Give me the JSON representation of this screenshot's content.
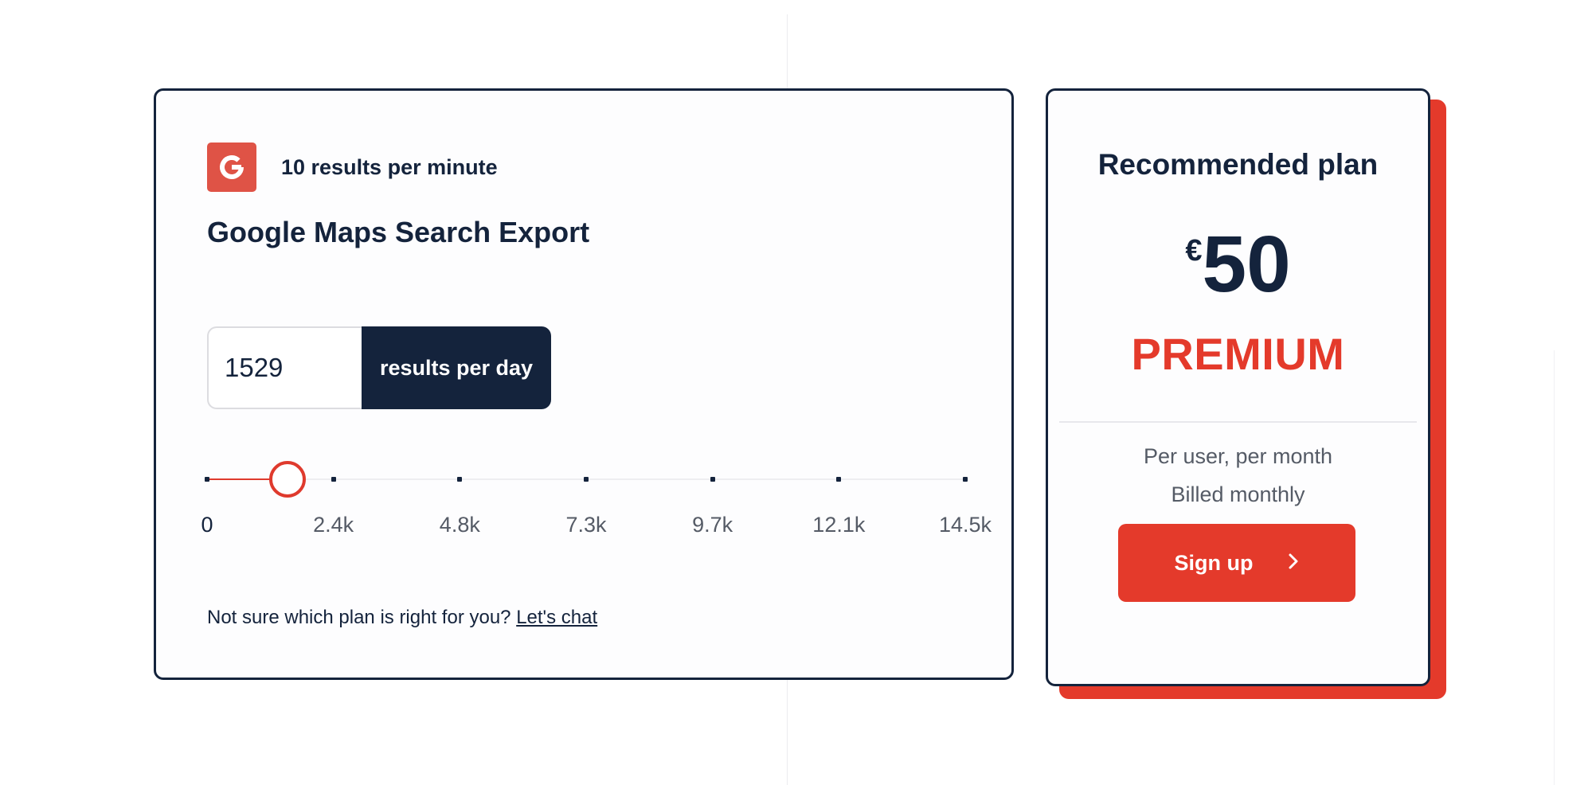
{
  "calculator": {
    "rate_text": "10 results per minute",
    "product_icon": "google-g-icon",
    "product_title": "Google Maps Search Export",
    "quantity_value": "1529",
    "quantity_unit": "results per day",
    "slider": {
      "value": 1529,
      "min": 0,
      "max": 14500,
      "ticks": [
        0,
        2400,
        4800,
        7300,
        9700,
        12100,
        14500
      ],
      "tick_labels": [
        "0",
        "2.4k",
        "4.8k",
        "7.3k",
        "9.7k",
        "12.1k",
        "14.5k"
      ]
    },
    "help_text": "Not sure which plan is right for you?",
    "help_link": "Let's chat"
  },
  "plan": {
    "heading": "Recommended plan",
    "currency": "€",
    "price": "50",
    "name": "PREMIUM",
    "meta_1": "Per user, per month",
    "meta_2": "Billed monthly",
    "signup_label": "Sign up",
    "signup_icon": "chevron-right-icon"
  },
  "colors": {
    "navy": "#14233c",
    "accent_red": "#e43a2b",
    "badge_red": "#df5346"
  }
}
